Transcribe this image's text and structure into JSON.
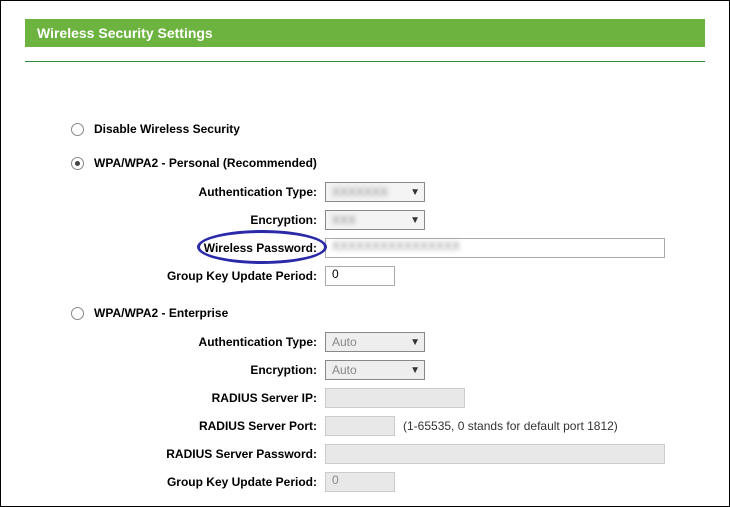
{
  "header": {
    "title": "Wireless Security Settings"
  },
  "options": {
    "disable": {
      "label": "Disable Wireless Security",
      "selected": false
    },
    "personal": {
      "label": "WPA/WPA2 - Personal (Recommended)",
      "selected": true,
      "fields": {
        "auth_type": {
          "label": "Authentication Type:",
          "value": ""
        },
        "encryption": {
          "label": "Encryption:",
          "value": ""
        },
        "wireless_password": {
          "label": "Wireless Password:",
          "value": ""
        },
        "group_key": {
          "label": "Group Key Update Period:",
          "value": "0"
        }
      }
    },
    "enterprise": {
      "label": "WPA/WPA2 - Enterprise",
      "selected": false,
      "fields": {
        "auth_type": {
          "label": "Authentication Type:",
          "value": "Auto"
        },
        "encryption": {
          "label": "Encryption:",
          "value": "Auto"
        },
        "radius_ip": {
          "label": "RADIUS Server IP:",
          "value": ""
        },
        "radius_port": {
          "label": "RADIUS Server Port:",
          "value": "",
          "hint": "(1-65535, 0 stands for default port 1812)"
        },
        "radius_password": {
          "label": "RADIUS Server Password:",
          "value": ""
        },
        "group_key": {
          "label": "Group Key Update Period:",
          "value": "0"
        }
      }
    }
  }
}
